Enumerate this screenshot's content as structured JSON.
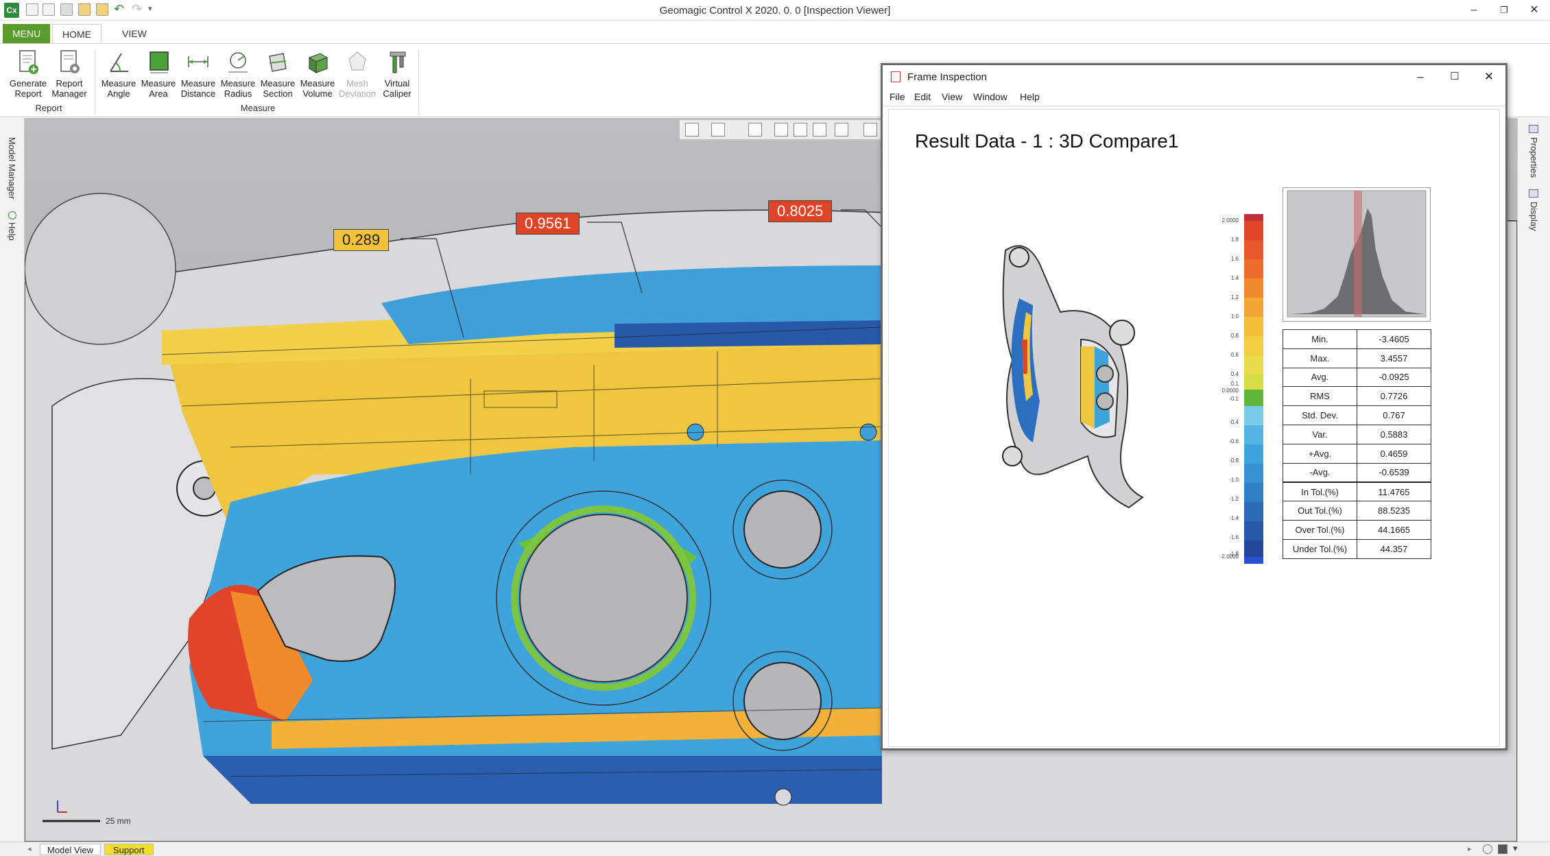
{
  "app": {
    "title": "Geomagic Control X 2020. 0. 0   [Inspection Viewer]",
    "logo_text": "Cx"
  },
  "ribbon": {
    "tabs": [
      "MENU",
      "HOME",
      "VIEW"
    ],
    "report_group": {
      "label": "Report",
      "buttons": [
        {
          "label1": "Generate",
          "label2": "Report",
          "icon": "generate-report-icon"
        },
        {
          "label1": "Report",
          "label2": "Manager",
          "icon": "report-manager-icon"
        }
      ]
    },
    "measure_group": {
      "label": "Measure",
      "buttons": [
        {
          "label1": "Measure",
          "label2": "Angle",
          "icon": "measure-angle-icon"
        },
        {
          "label1": "Measure",
          "label2": "Area",
          "icon": "measure-area-icon"
        },
        {
          "label1": "Measure",
          "label2": "Distance",
          "icon": "measure-distance-icon"
        },
        {
          "label1": "Measure",
          "label2": "Radius",
          "icon": "measure-radius-icon"
        },
        {
          "label1": "Measure",
          "label2": "Section",
          "icon": "measure-section-icon"
        },
        {
          "label1": "Measure",
          "label2": "Volume",
          "icon": "measure-volume-icon"
        },
        {
          "label1": "Mesh",
          "label2": "Deviation",
          "icon": "mesh-deviation-icon",
          "disabled": true
        },
        {
          "label1": "Virtual",
          "label2": "Caliper",
          "icon": "virtual-caliper-icon"
        }
      ]
    }
  },
  "left_panel": {
    "model_manager": "Model Manager",
    "help": "Help"
  },
  "right_panel": {
    "properties": "Properties",
    "display": "Display"
  },
  "viewport": {
    "callouts": [
      {
        "value": "0.289",
        "color": "#f2c33a"
      },
      {
        "value": "0.9561",
        "color": "#e04426"
      },
      {
        "value": "0.8025",
        "color": "#e04426"
      }
    ],
    "scale": "25 mm"
  },
  "bottom_tabs": {
    "model_view": "Model View",
    "support": "Support"
  },
  "report_window": {
    "title": "Frame Inspection",
    "menu": [
      "File",
      "Edit",
      "View",
      "Window",
      "Help"
    ],
    "result_title": "Result Data - 1   :   3D Compare1",
    "colorbar_ticks": [
      "2.0000",
      "1.8",
      "1.6",
      "1.4",
      "1.2",
      "1.0",
      "0.8",
      "0.6",
      "0.4",
      "0.1",
      "0.0000",
      "-0.1",
      "-0.4",
      "-0.6",
      "-0.8",
      "-1.0",
      "-1.2",
      "-1.4",
      "-1.6",
      "-1.8",
      "-2.0000"
    ],
    "stats": [
      {
        "key": "Min.",
        "value": "-3.4605"
      },
      {
        "key": "Max.",
        "value": "3.4557"
      },
      {
        "key": "Avg.",
        "value": "-0.0925"
      },
      {
        "key": "RMS",
        "value": "0.7726"
      },
      {
        "key": "Std. Dev.",
        "value": "0.767"
      },
      {
        "key": "Var.",
        "value": "0.5883"
      },
      {
        "key": "+Avg.",
        "value": "0.4659"
      },
      {
        "key": "-Avg.",
        "value": "-0.6539"
      },
      {
        "key": "In Tol.(%)",
        "value": "11.4765"
      },
      {
        "key": "Out Tol.(%)",
        "value": "88.5235"
      },
      {
        "key": "Over Tol.(%)",
        "value": "44.1665"
      },
      {
        "key": "Under Tol.(%)",
        "value": "44.357"
      }
    ]
  }
}
